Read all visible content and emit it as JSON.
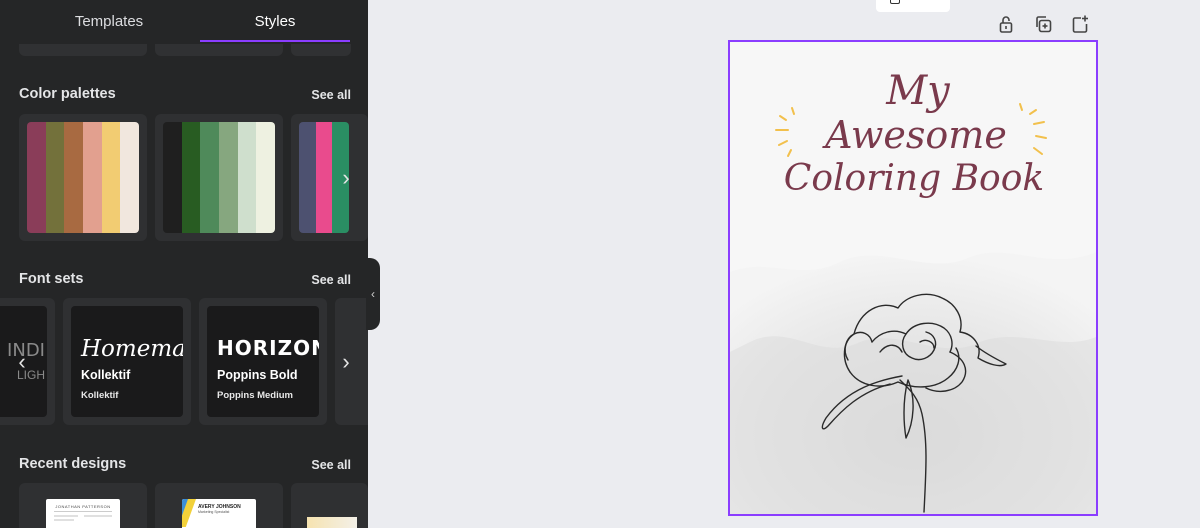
{
  "tabs": [
    {
      "label": "Templates",
      "active": false
    },
    {
      "label": "Styles",
      "active": true
    }
  ],
  "sections": {
    "color_palettes": {
      "title": "Color palettes",
      "see_all": "See all",
      "palettes": [
        [
          "#8a3d59",
          "#73713b",
          "#a86a41",
          "#e2a08f",
          "#f2cc72",
          "#f1e7de"
        ],
        [
          "#1f1f1f",
          "#285c22",
          "#4f8a5a",
          "#86a77f",
          "#cfdfcd",
          "#eef1e1"
        ],
        [
          "#4d5170",
          "#e94b8d",
          "#2a8e63"
        ]
      ],
      "palette_accent": "#8b3dff"
    },
    "font_sets": {
      "title": "Font sets",
      "see_all": "See all",
      "sets": [
        {
          "heading": "INDI",
          "sub1": "LIGH",
          "sub2": ""
        },
        {
          "heading": "Homemade",
          "sub1": "Kollektif",
          "sub2": "Kollektif"
        },
        {
          "heading": "HORIZON",
          "sub1": "Poppins Bold",
          "sub2": "Poppins Medium"
        }
      ]
    },
    "recent_designs": {
      "title": "Recent designs",
      "see_all": "See all",
      "designs": [
        {
          "heading": "JONATHAN PATTERSON"
        },
        {
          "heading": "AVERY JOHNSON",
          "sub": "Marketing Specialist"
        }
      ]
    }
  },
  "icons": {
    "prev_arrow": "‹",
    "next_arrow": "›",
    "collapse": "‹"
  },
  "page_toolbar": {
    "lock": "lock-icon",
    "duplicate": "duplicate-icon",
    "add_page": "add-page-icon"
  },
  "design": {
    "title_lines": [
      "My",
      "Awesome",
      "Coloring Book"
    ],
    "title_color": "#7a3a4c",
    "sparkle_color": "#f2c04c",
    "selection_color": "#8b3dff"
  }
}
